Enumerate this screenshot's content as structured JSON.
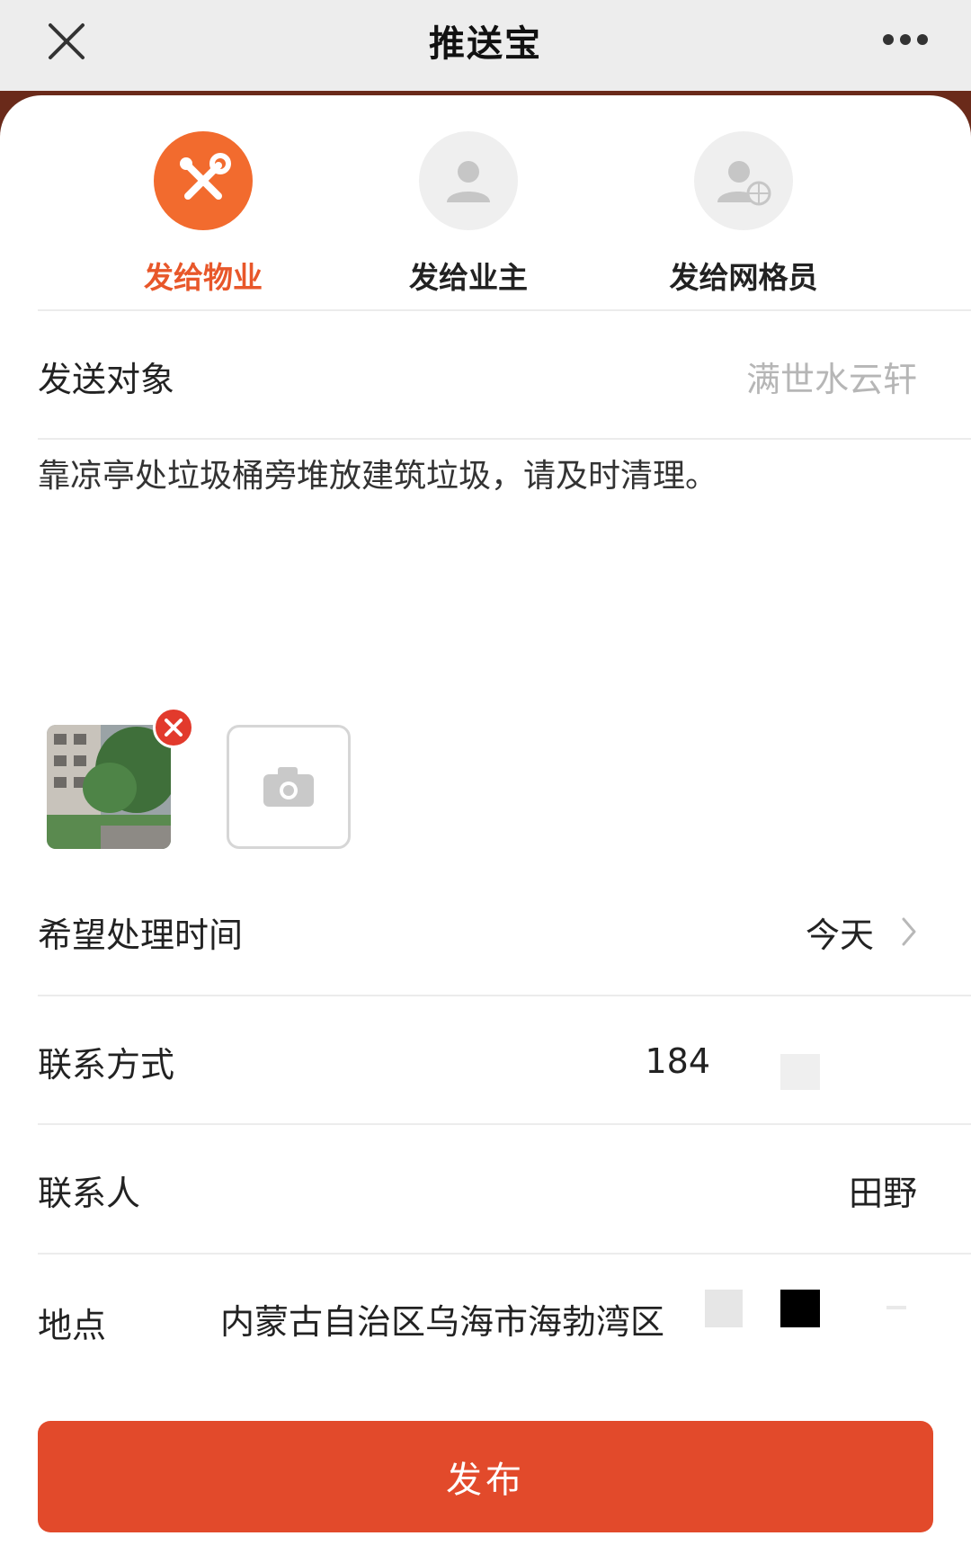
{
  "header": {
    "title": "推送宝"
  },
  "tabs": [
    {
      "label": "发给物业",
      "icon": "tools-icon",
      "active": true
    },
    {
      "label": "发给业主",
      "icon": "user-icon",
      "active": false
    },
    {
      "label": "发给网格员",
      "icon": "user-globe-icon",
      "active": false
    }
  ],
  "form": {
    "recipient": {
      "label": "发送对象",
      "value": "满世水云轩"
    },
    "message": "靠凉亭处垃圾桶旁堆放建筑垃圾，请及时清理。",
    "time": {
      "label": "希望处理时间",
      "value": "今天"
    },
    "phone": {
      "label": "联系方式",
      "value": "184"
    },
    "contact": {
      "label": "联系人",
      "value": "田野"
    },
    "location": {
      "label": "地点",
      "value": "内蒙古自治区乌海市海勃湾区"
    }
  },
  "publish_label": "发布",
  "colors": {
    "accent": "#e8572a",
    "button": "#e24a2b",
    "active_tab_circle": "#f26b2e",
    "header_bg": "#ededed",
    "band": "#6a2a1a"
  }
}
